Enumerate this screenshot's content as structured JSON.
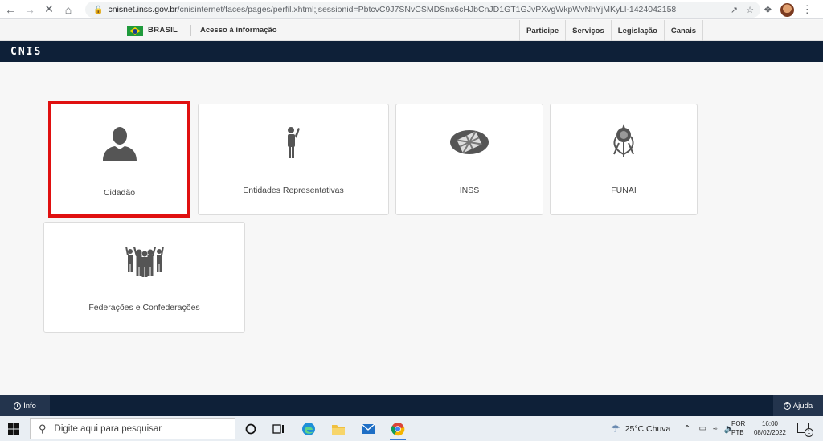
{
  "browser": {
    "url_host": "cnisnet.inss.gov.br",
    "url_path": "/cnisinternet/faces/pages/perfil.xhtml;jsessionid=PbtcvC9J7SNvCSMDSnx6cHJbCnJD1GT1GJvPXvgWkpWvNhYjMKyLl-1424042158"
  },
  "govbar": {
    "country": "BRASIL",
    "acesso": "Acesso à informação",
    "links": [
      "Participe",
      "Serviços",
      "Legislação",
      "Canais"
    ]
  },
  "app": {
    "logo": "CNIS"
  },
  "profiles": [
    {
      "label": "Cidadão",
      "icon": "user-silhouette-icon",
      "selected": true
    },
    {
      "label": "Entidades Representativas",
      "icon": "raised-hand-person-icon",
      "selected": false
    },
    {
      "label": "INSS",
      "icon": "inss-logo-icon",
      "selected": false
    },
    {
      "label": "FUNAI",
      "icon": "funai-emblem-icon",
      "selected": false
    },
    {
      "label": "Federações e Confederações",
      "icon": "group-raised-hands-icon",
      "selected": false
    }
  ],
  "footer": {
    "info": "Info",
    "ajuda": "Ajuda"
  },
  "taskbar": {
    "search_placeholder": "Digite aqui para pesquisar",
    "weather": "25°C  Chuva",
    "lang_top": "POR",
    "lang_bottom": "PTB",
    "time": "16:00",
    "date": "08/02/2022",
    "notif_count": "1"
  },
  "colors": {
    "header_bg": "#0e2038",
    "selection_border": "#e01010",
    "icon_gray": "#555555"
  }
}
